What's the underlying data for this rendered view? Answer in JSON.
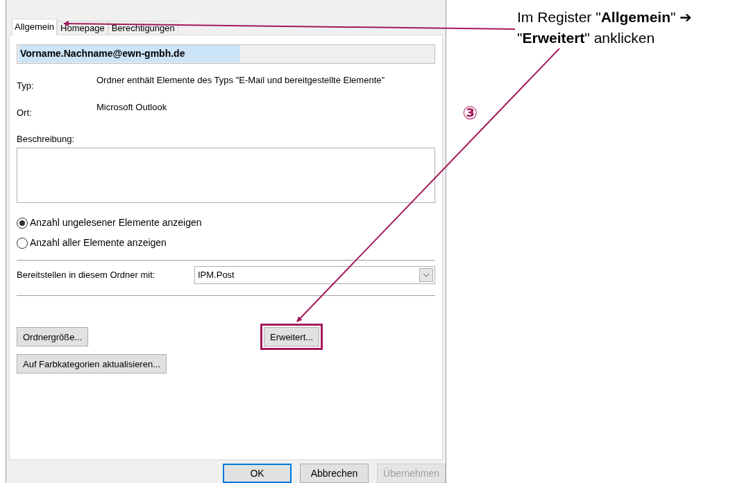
{
  "tabs": [
    {
      "label": "Allgemein",
      "selected": true
    },
    {
      "label": "Homepage",
      "selected": false
    },
    {
      "label": "Berechtigungen",
      "selected": false
    }
  ],
  "folder_name": {
    "value": "Vorname.Nachname@ewn-gmbh.de",
    "selected": true
  },
  "properties": [
    {
      "label": "Typ:",
      "value": "Ordner enthält Elemente des Typs \"E-Mail und bereitgestellte Elemente\""
    },
    {
      "label": "Ort:",
      "value": "Microsoft Outlook"
    }
  ],
  "description": {
    "label": "Beschreibung:"
  },
  "count_options": [
    {
      "label": "Anzahl ungelesener Elemente anzeigen",
      "selected": true
    },
    {
      "label": "Anzahl aller Elemente anzeigen",
      "selected": false
    }
  ],
  "post_form": {
    "label": "Bereitstellen in diesem Ordner mit:",
    "value": "IPM.Post"
  },
  "action_buttons": [
    {
      "label": "Ordnergröße...",
      "highlighted": false
    },
    {
      "label": "Erweitert...",
      "highlighted": true
    },
    {
      "label": "Auf Farbkategorien aktualisieren...",
      "highlighted": false
    }
  ],
  "dialog_buttons": [
    {
      "label": "OK",
      "default": true,
      "disabled": false
    },
    {
      "label": "Abbrechen",
      "default": false,
      "disabled": false
    },
    {
      "label": "Übernehmen",
      "default": false,
      "disabled": true
    }
  ],
  "annotation": {
    "lines": [
      "Im Register \"**Allgemein**\" ➔",
      "\"**Erweitert**\" anklicken"
    ],
    "step": "③"
  }
}
